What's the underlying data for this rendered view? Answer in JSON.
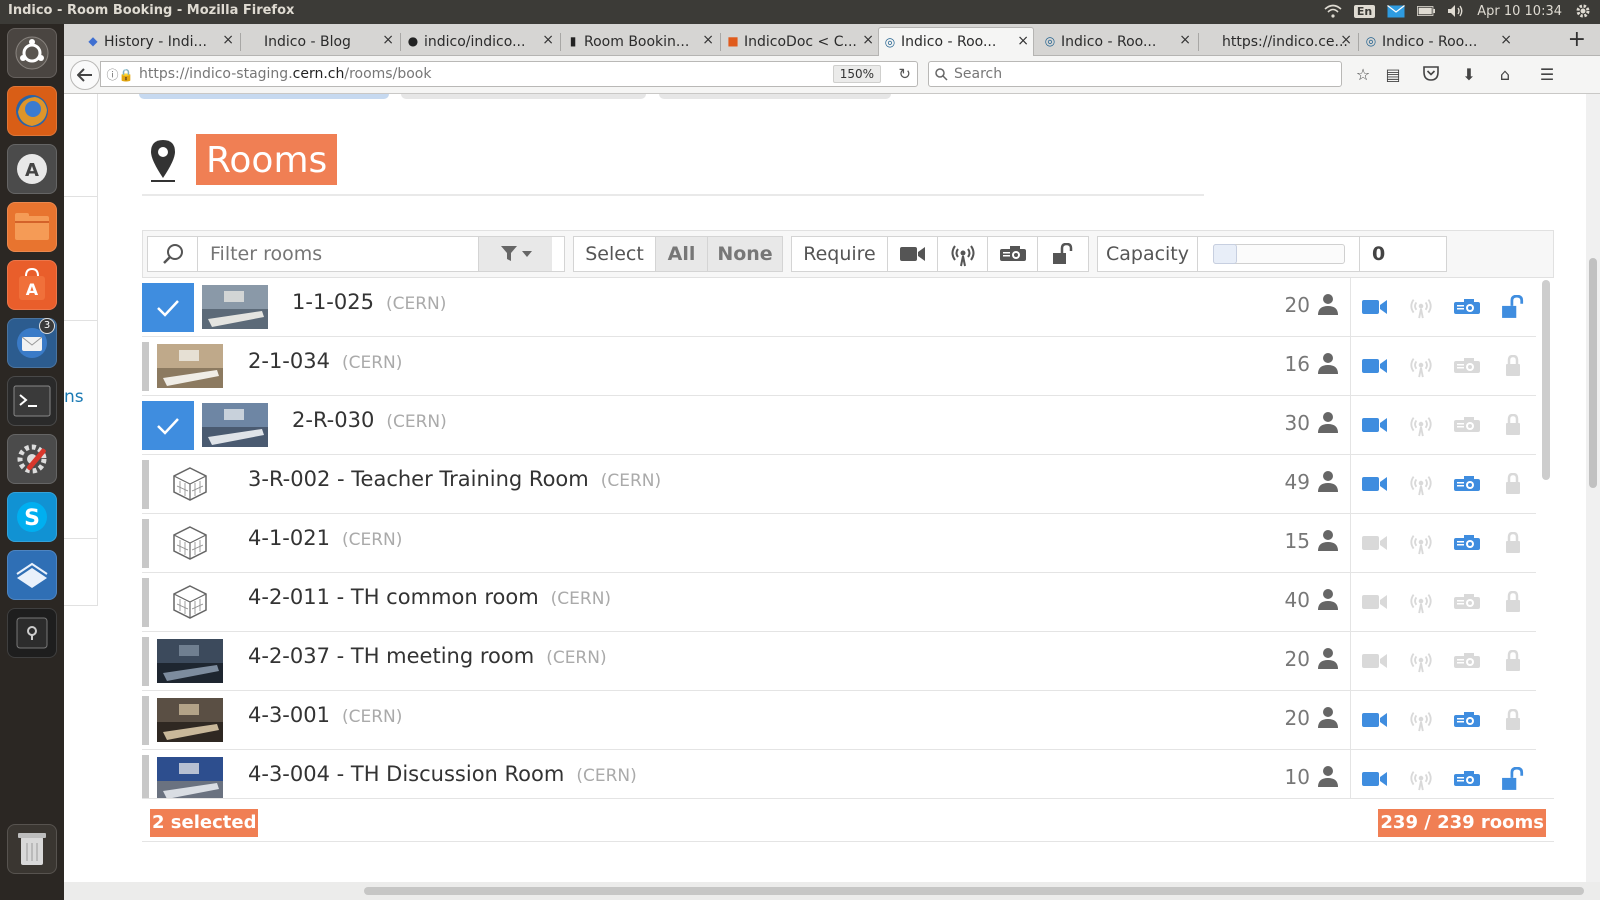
{
  "os_panel": {
    "window_title": "Indico - Room Booking - Mozilla Firefox",
    "keyboard_layout": "En",
    "clock": "Apr 10 10:34"
  },
  "launcher": {
    "thunderbird_badge": "3"
  },
  "browser": {
    "tabs": [
      {
        "label": "History - Indi...",
        "icon": "book-icon",
        "icon_color": "#3f6fd1"
      },
      {
        "label": "Indico - Blog",
        "icon": "",
        "icon_color": "#666"
      },
      {
        "label": "indico/indico...",
        "icon": "github-icon",
        "icon_color": "#222"
      },
      {
        "label": "Room Bookin...",
        "icon": "indico-icon",
        "icon_color": "#222"
      },
      {
        "label": "IndicoDoc < C...",
        "icon": "twiki-icon",
        "icon_color": "#e05b1c"
      },
      {
        "label": "Indico - Roo...",
        "icon": "indico-logo-icon",
        "icon_color": "#1e5f8d",
        "active": true
      },
      {
        "label": "Indico - Roo...",
        "icon": "indico-logo-icon",
        "icon_color": "#1e5f8d"
      },
      {
        "label": "https://indico.ce...",
        "icon": "",
        "icon_color": "#666"
      },
      {
        "label": "Indico - Roo...",
        "icon": "indico-logo-icon",
        "icon_color": "#1e5f8d"
      }
    ],
    "url_prefix": "https://indico-staging.",
    "url_domain": "cern.ch",
    "url_path": "/rooms/book",
    "zoom": "150%",
    "search_placeholder": "Search"
  },
  "sidebar": {
    "link_fragment": "ns"
  },
  "page": {
    "title": "Rooms",
    "filter_placeholder": "Filter rooms",
    "select_label": "Select",
    "select_all": "All",
    "select_none": "None",
    "require_label": "Require",
    "capacity_label": "Capacity",
    "capacity_value": "0",
    "capacity_level": 0
  },
  "colors": {
    "accent": "#f07f54",
    "selected": "#3f8ddf",
    "feature_on": "#3f8ddf",
    "feature_off": "#d9d9d9"
  },
  "rooms": [
    {
      "name": "1-1-025",
      "site": "(CERN)",
      "capacity": "20",
      "selected": true,
      "thumb": "photo",
      "features": {
        "video": true,
        "webcast": false,
        "vc": true,
        "unlocked": true
      }
    },
    {
      "name": "2-1-034",
      "site": "(CERN)",
      "capacity": "16",
      "selected": false,
      "thumb": "photo",
      "features": {
        "video": true,
        "webcast": false,
        "vc": false,
        "unlocked": false
      }
    },
    {
      "name": "2-R-030",
      "site": "(CERN)",
      "capacity": "30",
      "selected": true,
      "thumb": "photo",
      "features": {
        "video": true,
        "webcast": false,
        "vc": false,
        "unlocked": false
      }
    },
    {
      "name": "3-R-002 - Teacher Training Room",
      "site": "(CERN)",
      "capacity": "49",
      "selected": false,
      "thumb": "default",
      "features": {
        "video": true,
        "webcast": false,
        "vc": true,
        "unlocked": false
      }
    },
    {
      "name": "4-1-021",
      "site": "(CERN)",
      "capacity": "15",
      "selected": false,
      "thumb": "default",
      "features": {
        "video": false,
        "webcast": false,
        "vc": true,
        "unlocked": false
      }
    },
    {
      "name": "4-2-011 - TH common room",
      "site": "(CERN)",
      "capacity": "40",
      "selected": false,
      "thumb": "default",
      "features": {
        "video": false,
        "webcast": false,
        "vc": false,
        "unlocked": false
      }
    },
    {
      "name": "4-2-037 - TH meeting room",
      "site": "(CERN)",
      "capacity": "20",
      "selected": false,
      "thumb": "photo",
      "features": {
        "video": false,
        "webcast": false,
        "vc": false,
        "unlocked": false
      }
    },
    {
      "name": "4-3-001",
      "site": "(CERN)",
      "capacity": "20",
      "selected": false,
      "thumb": "photo",
      "features": {
        "video": true,
        "webcast": false,
        "vc": true,
        "unlocked": false
      }
    },
    {
      "name": "4-3-004 - TH Discussion Room",
      "site": "(CERN)",
      "capacity": "10",
      "selected": false,
      "thumb": "photo",
      "features": {
        "video": true,
        "webcast": false,
        "vc": true,
        "unlocked": true
      }
    }
  ],
  "footer": {
    "selected_count": "2 selected",
    "rooms_count": "239 / 239 rooms"
  }
}
